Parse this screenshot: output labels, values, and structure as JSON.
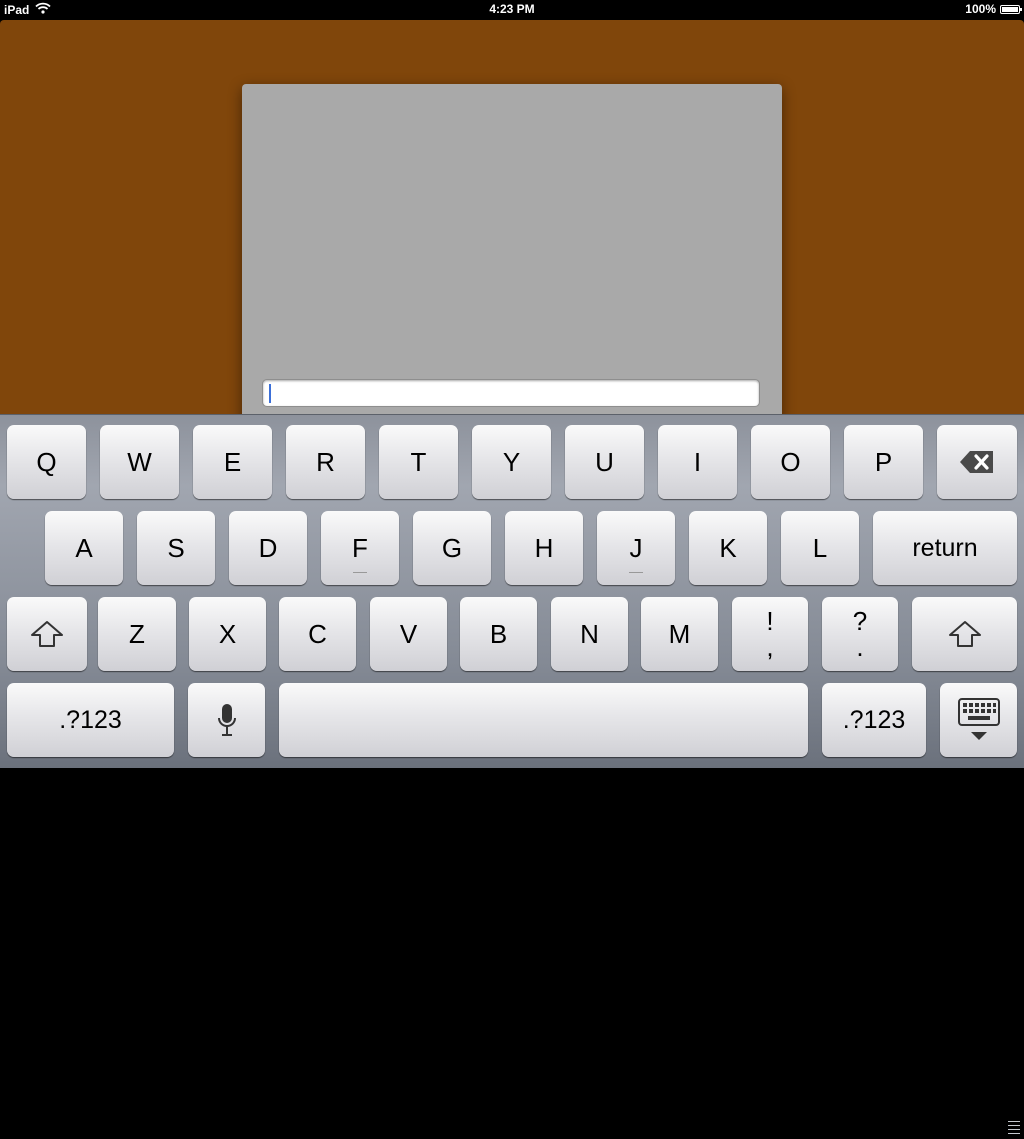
{
  "status_bar": {
    "device": "iPad",
    "time": "4:23 PM",
    "battery": "100%",
    "battery_level": 1.0
  },
  "dialog": {
    "text_field_value": ""
  },
  "keyboard": {
    "row1": [
      "Q",
      "W",
      "E",
      "R",
      "T",
      "Y",
      "U",
      "I",
      "O",
      "P"
    ],
    "row2": [
      "A",
      "S",
      "D",
      "F",
      "G",
      "H",
      "J",
      "K",
      "L"
    ],
    "return_label": "return",
    "row3": [
      "Z",
      "X",
      "C",
      "V",
      "B",
      "N",
      "M"
    ],
    "punct1": {
      "top": "!",
      "bottom": ","
    },
    "punct2": {
      "top": "?",
      "bottom": "."
    },
    "numbers_left_label": ".?123",
    "numbers_right_label": ".?123",
    "icons": {
      "backspace": "backspace-icon",
      "shift": "shift-icon",
      "dictation": "microphone-icon",
      "hide": "keyboard-hide-icon",
      "wifi": "wifi-icon",
      "battery": "battery-icon"
    }
  }
}
